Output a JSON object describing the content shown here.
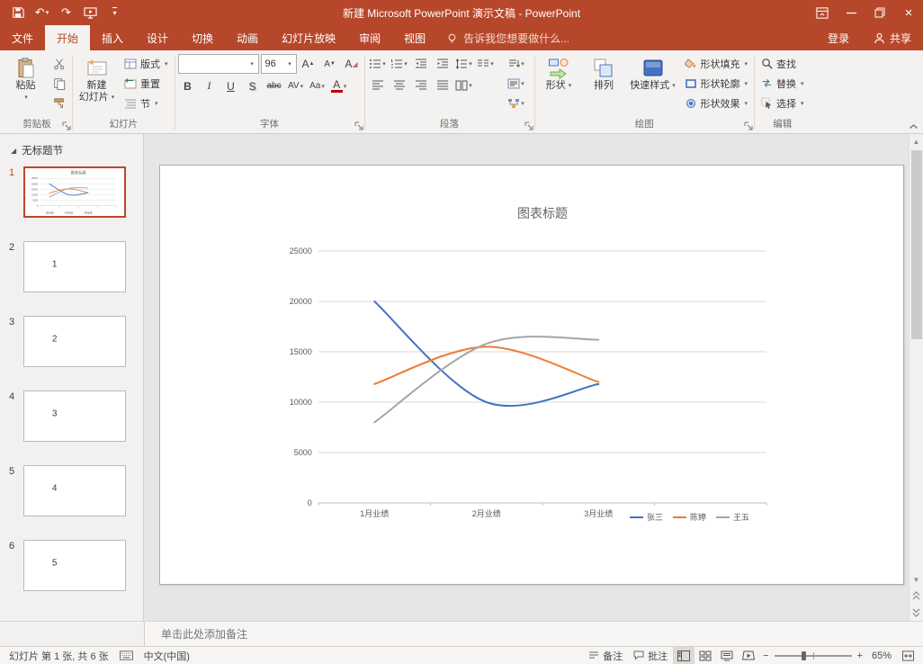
{
  "window": {
    "title": "新建 Microsoft PowerPoint 演示文稿 - PowerPoint",
    "sign_in": "登录",
    "share": "共享"
  },
  "tell_me": "告诉我您想要做什么...",
  "tabs": [
    {
      "label": "文件"
    },
    {
      "label": "开始"
    },
    {
      "label": "插入"
    },
    {
      "label": "设计"
    },
    {
      "label": "切换"
    },
    {
      "label": "动画"
    },
    {
      "label": "幻灯片放映"
    },
    {
      "label": "审阅"
    },
    {
      "label": "视图"
    }
  ],
  "ribbon": {
    "clipboard": {
      "group_label": "剪贴板",
      "paste": "粘贴"
    },
    "slides": {
      "group_label": "幻灯片",
      "new_slide_1": "新建",
      "new_slide_2": "幻灯片",
      "layout": "版式",
      "reset": "重置",
      "section": "节"
    },
    "font": {
      "group_label": "字体",
      "font_name": "",
      "font_size": "96",
      "bold": "B",
      "italic": "I",
      "underline": "U",
      "shadow": "S",
      "strike": "abc",
      "char_spacing": "AV",
      "change_case": "Aa",
      "font_color": "A"
    },
    "paragraph": {
      "group_label": "段落"
    },
    "drawing": {
      "group_label": "绘图",
      "shapes": "形状",
      "arrange": "排列",
      "quick_styles": "快速样式",
      "shape_fill": "形状填充",
      "shape_outline": "形状轮廓",
      "shape_effects": "形状效果"
    },
    "editing": {
      "group_label": "编辑",
      "find": "查找",
      "replace": "替换",
      "select": "选择"
    }
  },
  "thumbnails": {
    "section_label": "无标题节",
    "slides": [
      {
        "num": "1",
        "content": "chart",
        "selected": true
      },
      {
        "num": "2",
        "text": "1"
      },
      {
        "num": "3",
        "text": "2"
      },
      {
        "num": "4",
        "text": "3"
      },
      {
        "num": "5",
        "text": "4"
      },
      {
        "num": "6",
        "text": "5"
      }
    ]
  },
  "notes": {
    "placeholder": "单击此处添加备注"
  },
  "status_bar": {
    "slide_indicator": "幻灯片 第 1 张, 共 6 张",
    "language": "中文(中国)",
    "notes_button": "备注",
    "comments_button": "批注",
    "zoom_level": "65%"
  },
  "colors": {
    "titlebar": "#B7472A",
    "accent": "#B7472A",
    "series_blue": "#4472C4",
    "series_orange": "#ED7D31",
    "series_gray": "#A5A5A5"
  },
  "chart_data": {
    "type": "line",
    "title": "图表标题",
    "categories": [
      "1月业绩",
      "2月业绩",
      "3月业绩"
    ],
    "series": [
      {
        "name": "张三",
        "color": "#4472C4",
        "values": [
          20000,
          10000,
          11800
        ]
      },
      {
        "name": "陈婷",
        "color": "#ED7D31",
        "values": [
          11800,
          15500,
          12000
        ]
      },
      {
        "name": "王五",
        "color": "#A5A5A5",
        "values": [
          8000,
          15800,
          16200
        ]
      }
    ],
    "ylim": [
      0,
      25000
    ],
    "ystep": 5000,
    "grid": true,
    "smooth": true,
    "legend_position": "bottom-right"
  }
}
